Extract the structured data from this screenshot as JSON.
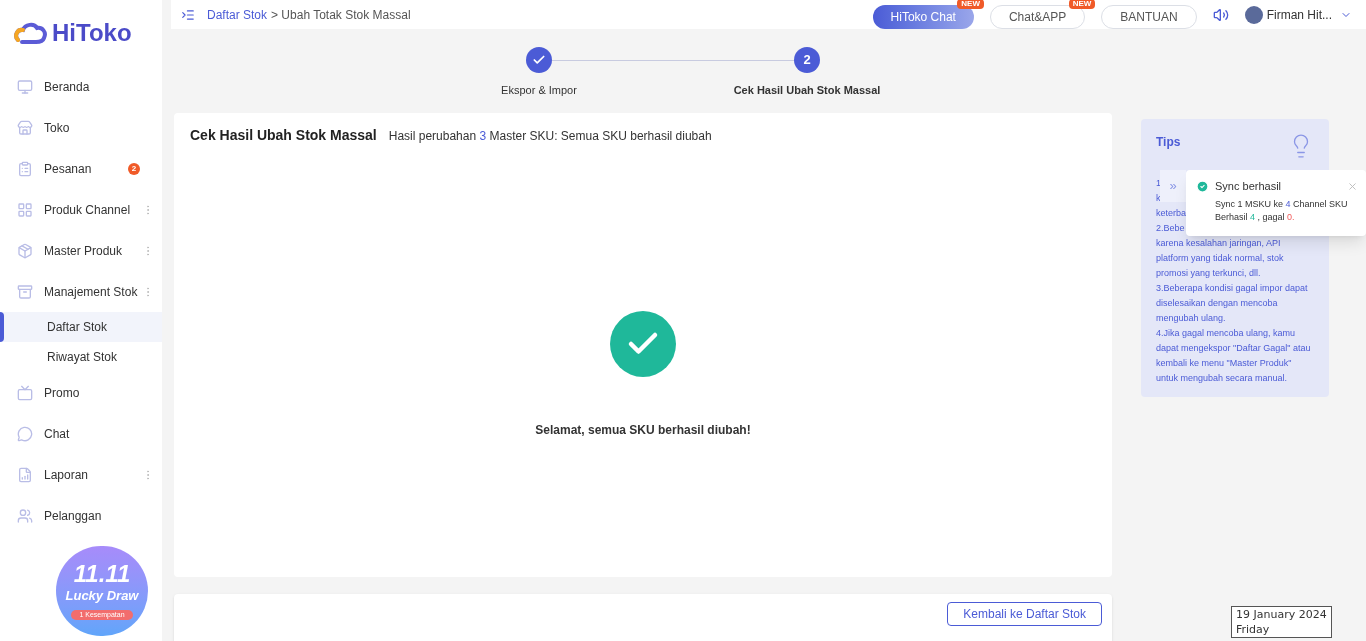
{
  "logo": "HiToko",
  "sidebar": {
    "items": [
      {
        "label": "Beranda",
        "has_menu": false
      },
      {
        "label": "Toko",
        "has_menu": false
      },
      {
        "label": "Pesanan",
        "has_menu": false,
        "badge": "2"
      },
      {
        "label": "Produk Channel",
        "has_menu": true
      },
      {
        "label": "Master Produk",
        "has_menu": true
      },
      {
        "label": "Manajement Stok",
        "has_menu": true,
        "children": [
          {
            "label": "Daftar Stok",
            "selected": true
          },
          {
            "label": "Riwayat Stok",
            "selected": false
          }
        ]
      },
      {
        "label": "Promo",
        "has_menu": false
      },
      {
        "label": "Chat",
        "has_menu": false
      },
      {
        "label": "Laporan",
        "has_menu": true
      },
      {
        "label": "Pelanggan",
        "has_menu": false
      }
    ],
    "promo": {
      "title_1": "11.11",
      "title_2": "Lucky Draw",
      "badge": "1 Kesempatan"
    }
  },
  "breadcrumb": {
    "link": "Daftar Stok",
    "current": "> Ubah Totak Stok Massal"
  },
  "header_buttons": [
    {
      "label": "HiToko Chat",
      "kind": "primary",
      "badge": "NEW"
    },
    {
      "label": "Chat&APP",
      "kind": "outline",
      "badge": "NEW"
    },
    {
      "label": "BANTUAN",
      "kind": "outline"
    }
  ],
  "user": {
    "name": "Firman Hit..."
  },
  "steps": [
    {
      "label": "Ekspor & Impor",
      "done": true
    },
    {
      "label": "Cek Hasil Ubah Stok Massal",
      "done": false,
      "number": "2"
    }
  ],
  "result": {
    "title": "Cek Hasil Ubah Stok Massal",
    "summary": "Hasil perubahan **3** Master SKU: Semua SKU berhasil diubah",
    "message": "Selamat, semua SKU berhasil diubah!"
  },
  "back_button": "Kembali ke Daftar Stok",
  "tips": {
    "title": "Tips",
    "lines": [
      "1",
      "k",
      "keterba",
      "2.Bebe",
      "karena kesalahan jaringan, API",
      "platform yang tidak normal, stok",
      "promosi yang terkunci, dll.",
      "3.Beberapa kondisi gagal impor dapat",
      "diselesaikan dengan mencoba",
      "mengubah ulang.",
      "4.Jika gagal mencoba ulang, kamu",
      "dapat mengekspor \"Daftar Gagal\" atau",
      "kembali ke menu \"Master Produk\"",
      "untuk mengubah secara manual."
    ]
  },
  "toast": {
    "collapse": "»",
    "title": "Sync berhasil",
    "line_1": "Sync 1 MSKU ke **4** Channel SKU",
    "success_label": "Berhasil",
    "success": "4",
    "fail_label": ", gagal",
    "fail": "0."
  },
  "date_tooltip": {
    "date": "19 January 2024",
    "day": "Friday"
  }
}
